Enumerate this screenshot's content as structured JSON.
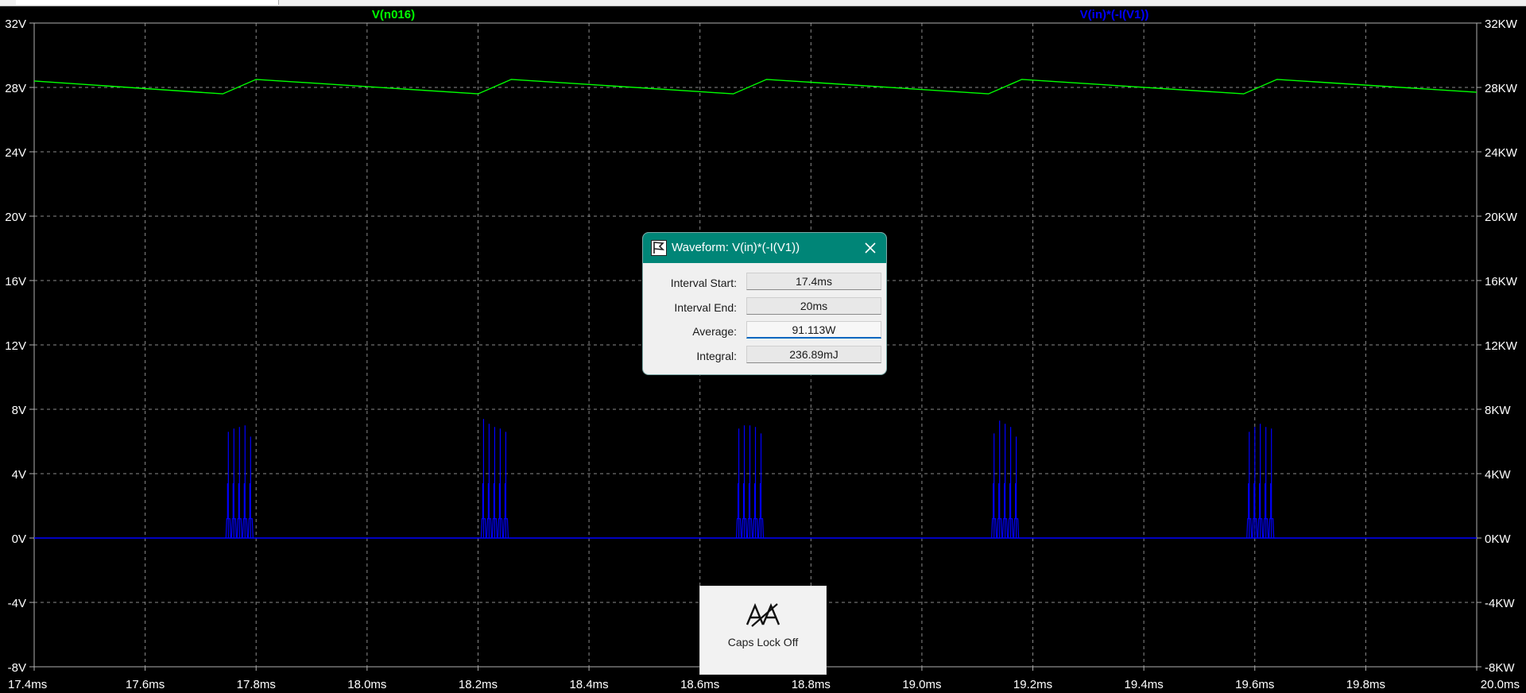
{
  "plot": {
    "trace_labels": [
      {
        "text": "V(n016)",
        "color": "#00ff00"
      },
      {
        "text": "V(in)*(-I(V1))",
        "color": "#0000ff"
      }
    ],
    "left_axis_ticks": [
      "32V",
      "28V",
      "24V",
      "20V",
      "16V",
      "12V",
      "8V",
      "4V",
      "0V",
      "-4V",
      "-8V"
    ],
    "right_axis_ticks": [
      "32KW",
      "28KW",
      "24KW",
      "20KW",
      "16KW",
      "12KW",
      "8KW",
      "4KW",
      "0KW",
      "-4KW",
      "-8KW"
    ],
    "x_axis_ticks": [
      "17.4ms",
      "17.6ms",
      "17.8ms",
      "18.0ms",
      "18.2ms",
      "18.4ms",
      "18.6ms",
      "18.8ms",
      "19.0ms",
      "19.2ms",
      "19.4ms",
      "19.6ms",
      "19.8ms",
      "20.0ms"
    ]
  },
  "chart_data": {
    "type": "line",
    "title": "",
    "xlabel": "",
    "ylabel": "",
    "xlim_ms": [
      17.4,
      20.0
    ],
    "ylim_left_V": [
      -8,
      32
    ],
    "ylim_right_KW": [
      -8,
      32
    ],
    "grid": true,
    "series": [
      {
        "name": "V(n016)",
        "axis": "left",
        "color": "#00ff00",
        "x_ms": [
          17.4,
          17.74,
          17.8,
          18.2,
          18.26,
          18.66,
          18.72,
          19.12,
          19.18,
          19.58,
          19.64,
          20.0
        ],
        "y_V": [
          28.4,
          27.6,
          28.5,
          27.6,
          28.5,
          27.6,
          28.5,
          27.6,
          28.5,
          27.6,
          28.5,
          27.7
        ]
      },
      {
        "name": "V(in)*(-I(V1))",
        "axis": "right",
        "color": "#0000ff",
        "burst_centers_ms": [
          17.77,
          18.23,
          18.69,
          19.15,
          19.61
        ],
        "burst_peaks_KW": [
          [
            6.6,
            6.8,
            6.9,
            7.0,
            6.3
          ],
          [
            7.4,
            7.1,
            6.9,
            6.8,
            6.6
          ],
          [
            6.8,
            7.0,
            7.0,
            6.9,
            6.5
          ],
          [
            6.5,
            7.3,
            7.1,
            6.9,
            6.3
          ],
          [
            6.6,
            6.9,
            7.1,
            6.9,
            6.8
          ]
        ],
        "baseline_KW": 0
      }
    ]
  },
  "dialog": {
    "title": "Waveform: V(in)*(-I(V1))",
    "rows": [
      {
        "label": "Interval Start:",
        "value": "17.4ms"
      },
      {
        "label": "Interval End:",
        "value": "20ms"
      },
      {
        "label": "Average:",
        "value": "91.113W"
      },
      {
        "label": "Integral:",
        "value": "236.89mJ"
      }
    ]
  },
  "capslock": {
    "label": "Caps Lock Off",
    "icon": "caps-lock-off-icon"
  }
}
